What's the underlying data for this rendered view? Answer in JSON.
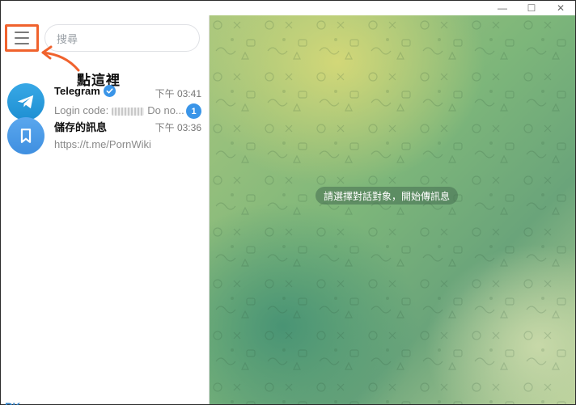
{
  "titlebar": {
    "minimize_glyph": "—",
    "maximize_glyph": "☐",
    "close_glyph": "✕"
  },
  "sidebar": {
    "menu_icon": "hamburger-menu-icon",
    "search_placeholder": "搜尋",
    "annotation_text": "點這裡",
    "chats": [
      {
        "name": "Telegram",
        "verified": true,
        "time": "下午 03:41",
        "preview_prefix": "Login code:",
        "preview_suffix": "Do no...",
        "unread": "1",
        "icon": "telegram-plane-icon"
      },
      {
        "name": "儲存的訊息",
        "time": "下午 03:36",
        "preview": "https://t.me/PornWiki",
        "icon": "bookmark-icon"
      }
    ],
    "watermark": "PK"
  },
  "main": {
    "empty_message": "請選擇對話對象，開始傳訊息"
  },
  "colors": {
    "accent": "#3a95e8",
    "annotation": "#f0622d"
  }
}
